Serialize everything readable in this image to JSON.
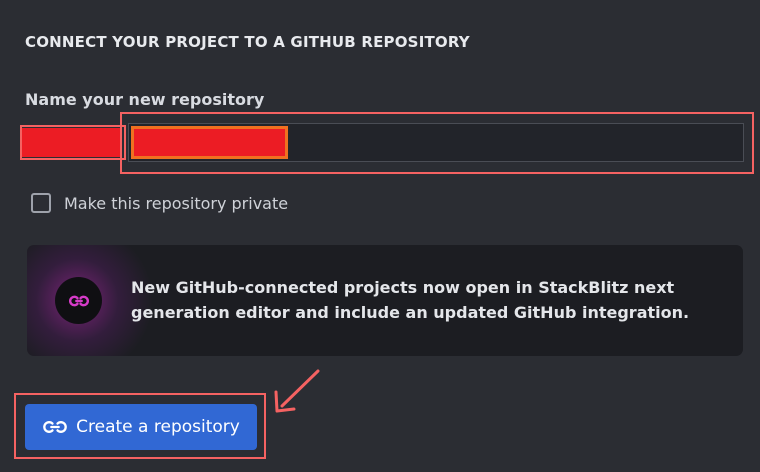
{
  "section": {
    "heading": "CONNECT YOUR PROJECT TO A GITHUB REPOSITORY"
  },
  "repository_form": {
    "name_label": "Name your new repository",
    "owner_value": "",
    "name_value": "",
    "private_checkbox": {
      "label": "Make this repository private",
      "checked": false
    }
  },
  "notice": {
    "icon": "stackblitz-link-icon",
    "text": "New GitHub-connected projects now open in StackBlitz next generation editor and include an updated GitHub integration."
  },
  "create_button": {
    "label": "Create a repository",
    "icon": "link-icon"
  },
  "colors": {
    "background": "#2b2d33",
    "accent_button": "#3168d4",
    "annotation_red": "#f56262",
    "redaction_red": "#ec1c24",
    "notice_glow": "#c828be"
  }
}
